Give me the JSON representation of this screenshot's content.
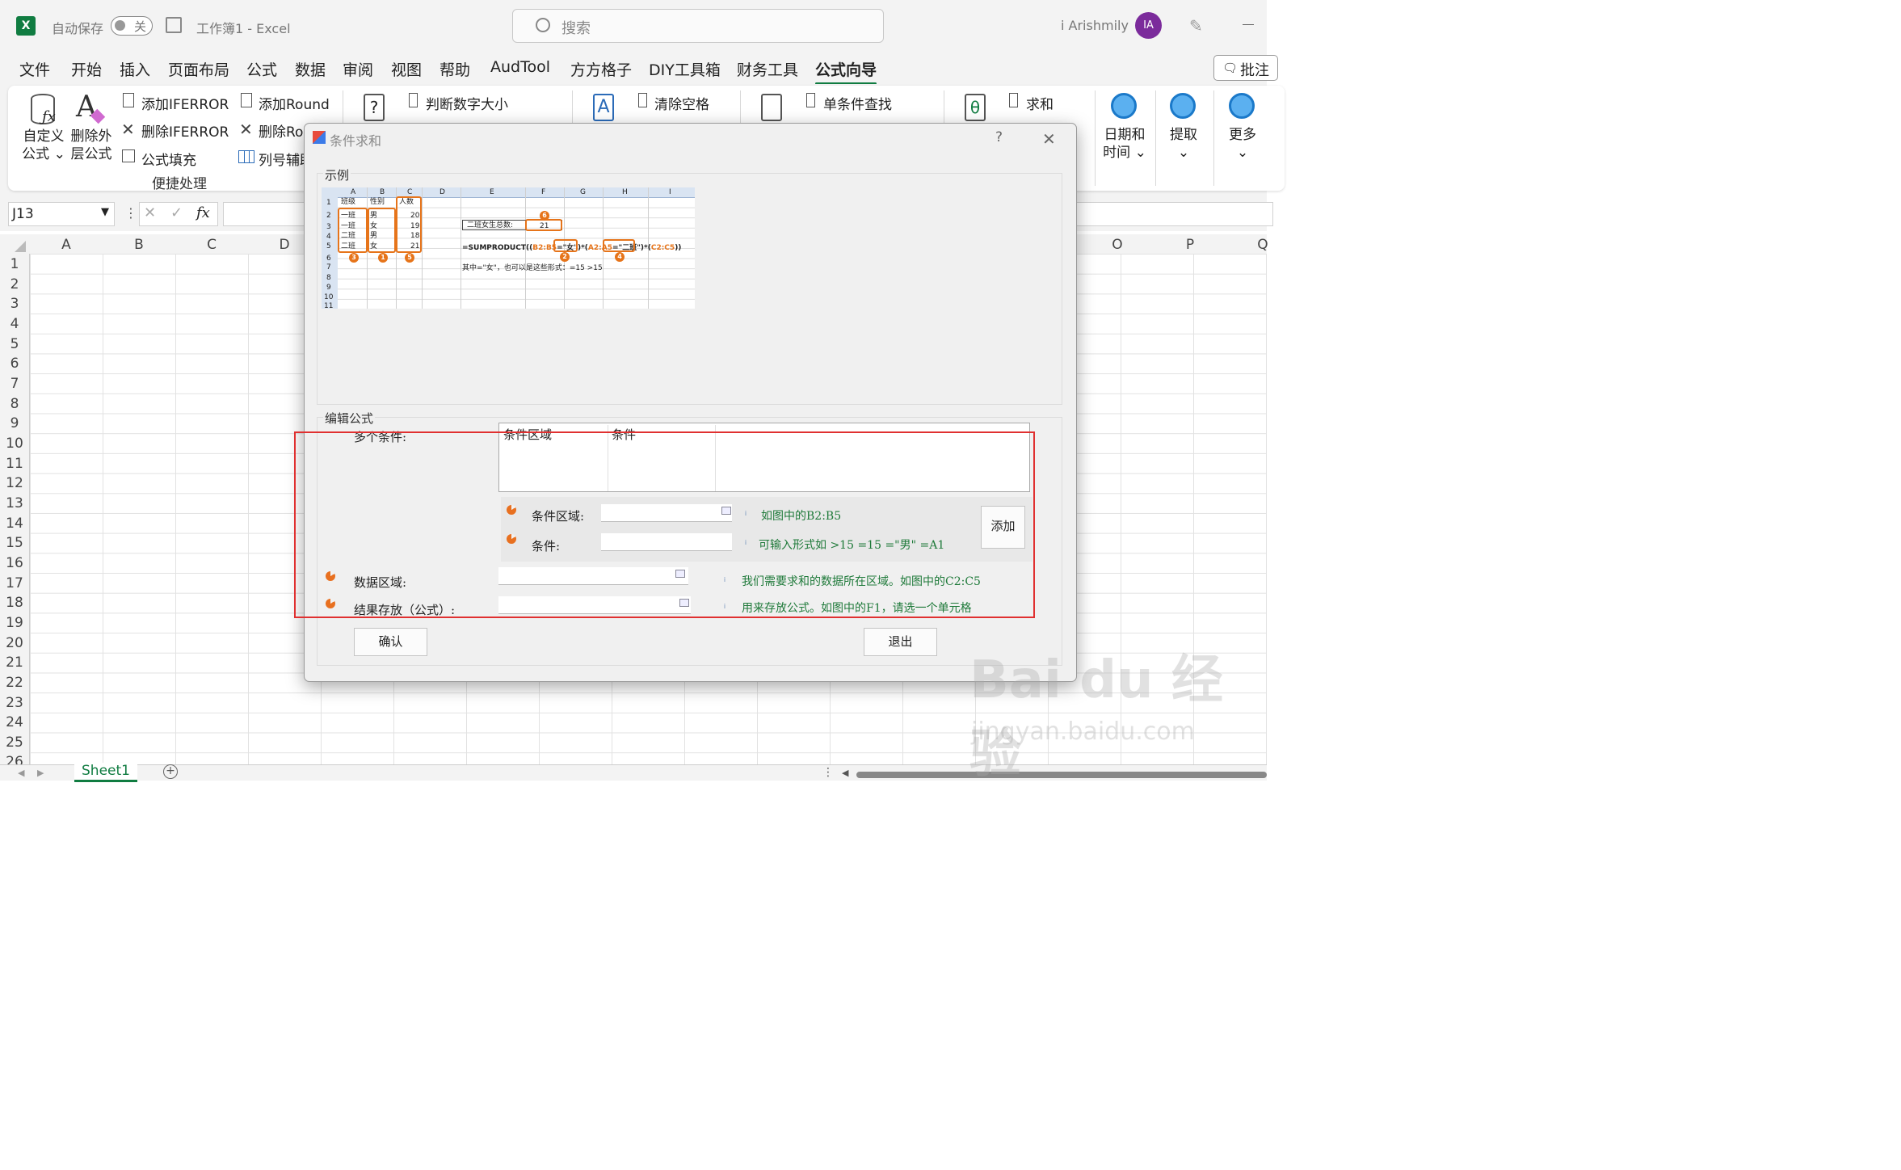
{
  "titlebar": {
    "autosave_label": "自动保存",
    "autosave_state": "关",
    "doc_title": "工作簿1  -  Excel",
    "search_placeholder": "搜索",
    "user_name": "i Arishmily",
    "user_initials": "IA"
  },
  "menu": {
    "tabs": [
      "文件",
      "开始",
      "插入",
      "页面布局",
      "公式",
      "数据",
      "审阅",
      "视图",
      "帮助",
      "AudTool",
      "方方格子",
      "DIY工具箱",
      "财务工具",
      "公式向导"
    ],
    "active": "公式向导",
    "comments_button": "批注"
  },
  "ribbon": {
    "custom_formula": [
      "自定义",
      "公式 ⌄"
    ],
    "remove_outer": [
      "删除外",
      "层公式"
    ],
    "add_iferror": "添加IFERROR",
    "del_iferror": "删除IFERROR",
    "formula_fill": "公式填充",
    "add_round": "添加Round",
    "del_round": "删除Ro",
    "col_helper": "列号辅助",
    "group_label": "便捷处理",
    "judge_num": "判断数字大小",
    "clear_space": "清除空格",
    "single_lookup": "单条件查找",
    "sum": "求和",
    "datetime": [
      "日期和",
      "时间 ⌄"
    ],
    "extract": [
      "提取",
      "⌄"
    ],
    "more": [
      "更多",
      "⌄"
    ]
  },
  "formula_bar": {
    "name_box": "J13",
    "fx": "fx"
  },
  "columns": [
    "A",
    "B",
    "C",
    "D",
    "O",
    "P",
    "Q"
  ],
  "rows": [
    "1",
    "2",
    "3",
    "4",
    "5",
    "6",
    "7",
    "8",
    "9",
    "10",
    "11",
    "12",
    "13",
    "14",
    "15",
    "16",
    "17",
    "18",
    "19",
    "20",
    "21",
    "22",
    "23",
    "24",
    "25",
    "26"
  ],
  "sheet_tab": "Sheet1",
  "dialog": {
    "title": "条件求和",
    "help": "?",
    "close": "✕",
    "sample_label": "示例",
    "edit_label": "编辑公式",
    "multi_cond_label": "多个条件:",
    "list_headers": [
      "条件区域",
      "条件"
    ],
    "cond_range_label": "条件区域:",
    "cond_range_hint": "如图中的B2:B5",
    "cond_label": "条件:",
    "cond_hint": "可输入形式如  >15   =15   =\"男\"   =A1",
    "add_button": "添加",
    "data_range_label": "数据区域:",
    "data_range_hint": "我们需要求和的数据所在区域。如图中的C2:C5",
    "result_label": "结果存放（公式）:",
    "result_hint": "用来存放公式。如图中的F1，请选一个单元格",
    "ok_button": "确认",
    "exit_button": "退出"
  },
  "sample": {
    "col_letters": [
      "A",
      "B",
      "C",
      "D",
      "E",
      "F",
      "G",
      "H",
      "I"
    ],
    "row_numbers": [
      "1",
      "2",
      "3",
      "4",
      "5",
      "6",
      "7",
      "8",
      "9",
      "10",
      "11"
    ],
    "headers": [
      "班级",
      "性别",
      "人数"
    ],
    "class_col": [
      "一班",
      "一班",
      "二班",
      "二班"
    ],
    "gender_col": [
      "男",
      "女",
      "男",
      "女"
    ],
    "count_col": [
      "20",
      "19",
      "18",
      "21"
    ],
    "total_label": "二班女生总数:",
    "total_value": "21",
    "formula_parts": [
      "=SUMPRODUCT((",
      "B2:B5",
      "=\"女\")*(",
      "A2:A5",
      "=\"二班\")*(",
      "C2:C5",
      "))"
    ],
    "note": "其中=\"女\"，也可以是这些形式：=15      >15",
    "markers": [
      "1",
      "2",
      "3",
      "4",
      "5",
      "6"
    ]
  },
  "watermark": {
    "main": "Bai du 经验",
    "sub": "jingyan.baidu.com"
  }
}
